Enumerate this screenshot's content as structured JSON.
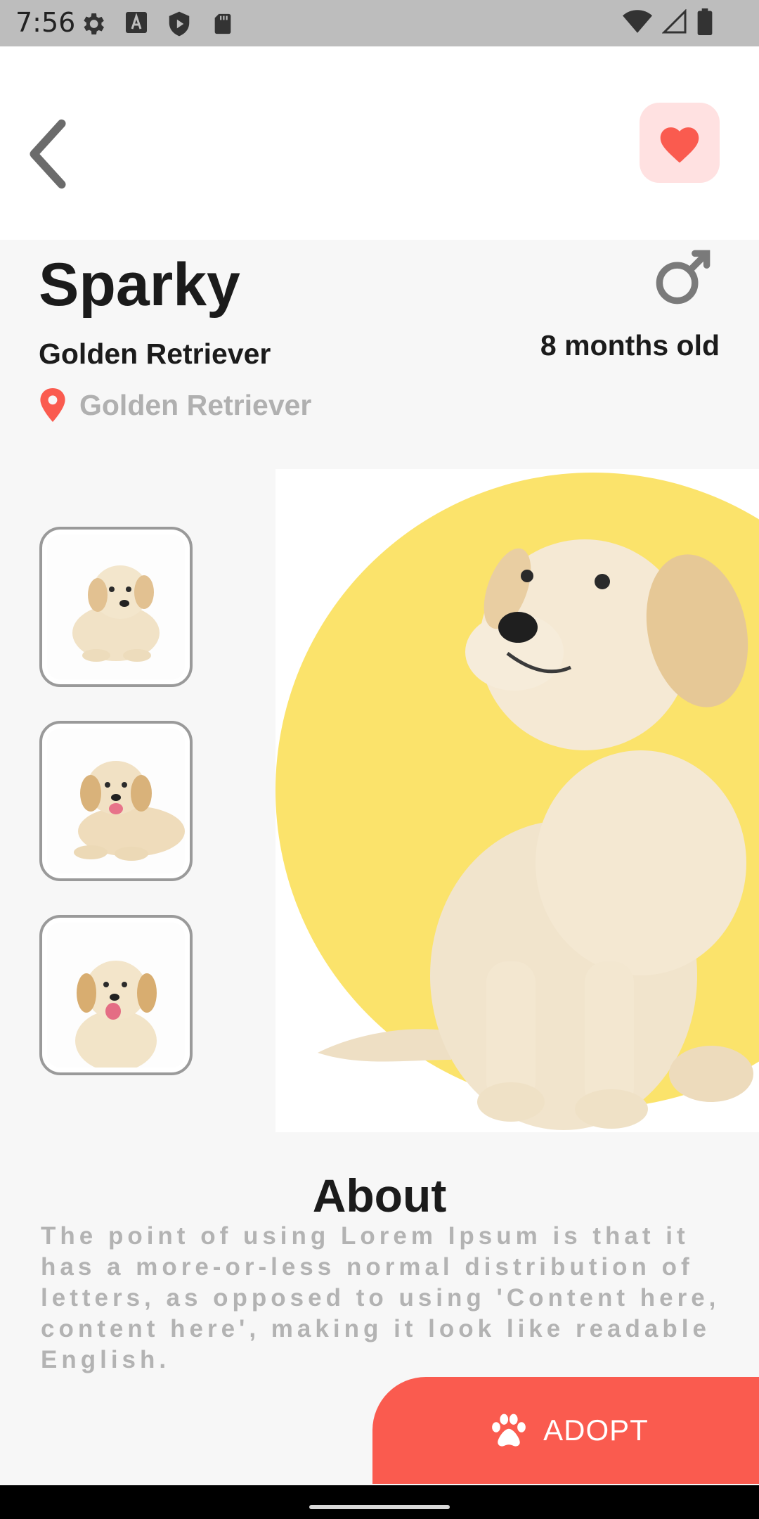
{
  "status_bar": {
    "time": "7:56",
    "left_icons": [
      "settings-icon",
      "text-a-icon",
      "shield-icon",
      "sd-card-icon"
    ],
    "right_icons": [
      "wifi-icon",
      "signal-icon",
      "battery-icon"
    ]
  },
  "header": {
    "back_icon": "chevron-left-icon",
    "favorite_icon": "heart-icon",
    "favorite_color": "#fa5b4f",
    "favorite_bg": "#ffe1e1"
  },
  "pet": {
    "name": "Sparky",
    "breed": "Golden Retriever",
    "location": "Golden Retriever",
    "gender_icon": "male-icon",
    "age": "8 months old"
  },
  "gallery": {
    "thumbnails": [
      "puppy-lying-photo",
      "puppy-smiling-photo",
      "puppy-open-mouth-photo"
    ],
    "main_image": "puppy-sitting-photo",
    "accent_color": "#fbe36b"
  },
  "about": {
    "title": "About",
    "text": " The point of using Lorem Ipsum is that it has a more-or-less normal distribution of letters, as opposed to using 'Content here, content here', making it look like readable English."
  },
  "adopt_button": {
    "label": "ADOPT",
    "icon": "paw-icon",
    "color": "#fa5b4f"
  }
}
